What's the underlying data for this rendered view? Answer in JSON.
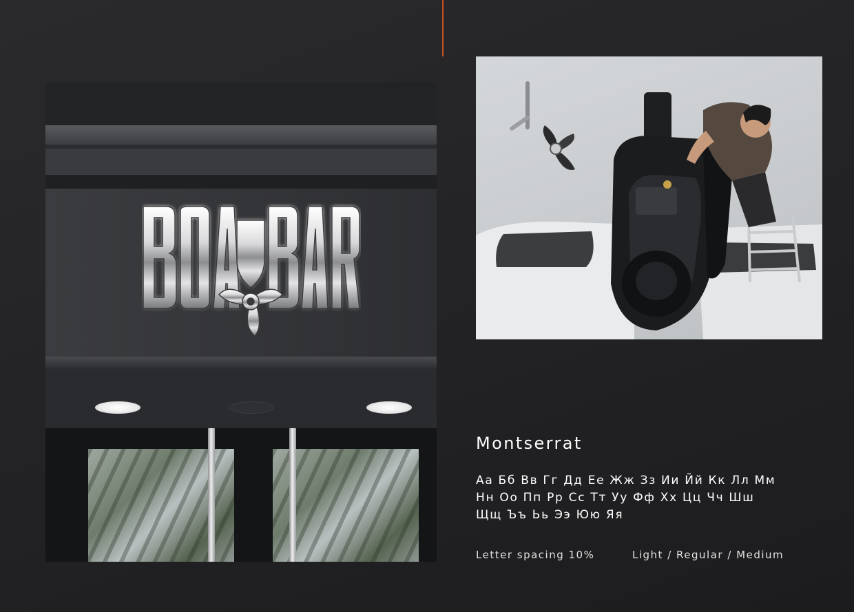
{
  "accent_color": "#c4511f",
  "storefront_image": {
    "sign": {
      "brand_text": "BOATBAR",
      "icon": "propeller-shield-icon"
    }
  },
  "workshop_image": {
    "icons": [
      "outboard-motor-icon",
      "propeller-icon",
      "boat-ladder-icon",
      "person-icon"
    ]
  },
  "typography": {
    "font_name": "Montserrat",
    "alphabet_lines": [
      "Аа Бб Вв Гг Дд Ее Жж Зз Ии Йй Кк Лл Мм",
      "Нн Оо Пп Рр Сс Тт Уу Фф Хх Цц Чч Шш",
      "Щщ Ъъ Ьь Ээ Юю Яя"
    ],
    "letter_spacing": "Letter spacing 10%",
    "weights": "Light / Regular / Medium"
  }
}
